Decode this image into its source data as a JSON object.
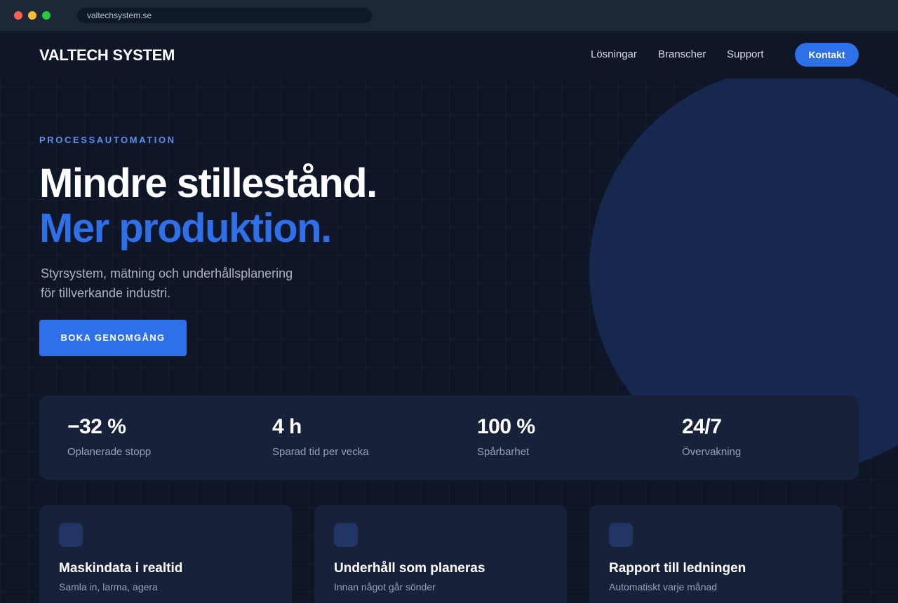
{
  "browser": {
    "url": "valtechsystem.se"
  },
  "header": {
    "brand": "VALTECH SYSTEM",
    "nav": [
      "Lösningar",
      "Branscher",
      "Support"
    ],
    "contact_label": "Kontakt"
  },
  "hero": {
    "eyebrow": "PROCESSAUTOMATION",
    "headline_line1": "Mindre stillestånd.",
    "headline_line2": "Mer produktion.",
    "lead_line1": "Styrsystem, mätning och underhållsplanering",
    "lead_line2": "för tillverkande industri.",
    "cta_label": "BOKA GENOMGÅNG"
  },
  "stats": [
    {
      "value": "−32 %",
      "label": "Oplanerade stopp"
    },
    {
      "value": "4 h",
      "label": "Sparad tid per vecka"
    },
    {
      "value": "100 %",
      "label": "Spårbarhet"
    },
    {
      "value": "24/7",
      "label": "Övervakning"
    }
  ],
  "features": [
    {
      "title": "Maskindata i realtid",
      "text": "Samla in, larma, agera"
    },
    {
      "title": "Underhåll som planeras",
      "text": "Innan något går sönder"
    },
    {
      "title": "Rapport till ledningen",
      "text": "Automatiskt varje månad"
    }
  ],
  "colors": {
    "accent": "#2f6fe8",
    "background": "#0e1627",
    "card": "#17223a",
    "eyebrow": "#5f8fee"
  }
}
